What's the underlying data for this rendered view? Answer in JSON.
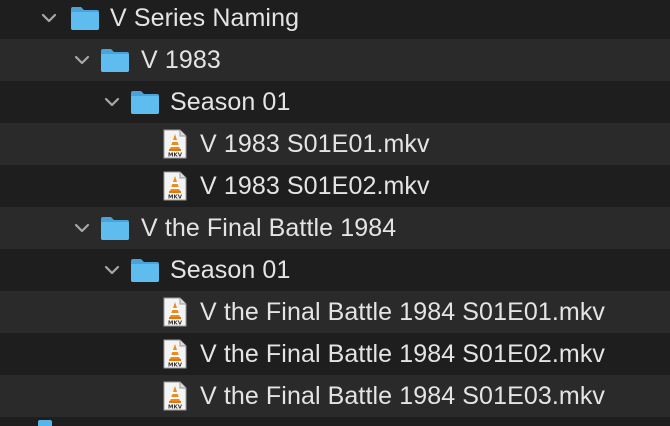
{
  "tree": {
    "rows": [
      {
        "kind": "folder",
        "label": "V Series Naming",
        "level": 0,
        "expanded": true
      },
      {
        "kind": "folder",
        "label": "V 1983",
        "level": 1,
        "expanded": true
      },
      {
        "kind": "folder",
        "label": "Season 01",
        "level": 2,
        "expanded": true
      },
      {
        "kind": "file",
        "label": "V 1983 S01E01.mkv",
        "level": 3
      },
      {
        "kind": "file",
        "label": "V 1983 S01E02.mkv",
        "level": 3
      },
      {
        "kind": "folder",
        "label": "V the Final Battle 1984",
        "level": 1,
        "expanded": true
      },
      {
        "kind": "folder",
        "label": "Season 01",
        "level": 2,
        "expanded": true
      },
      {
        "kind": "file",
        "label": "V the Final Battle 1984 S01E01.mkv",
        "level": 3
      },
      {
        "kind": "file",
        "label": "V the Final Battle 1984 S01E02.mkv",
        "level": 3
      },
      {
        "kind": "file",
        "label": "V the Final Battle 1984 S01E03.mkv",
        "level": 3
      }
    ]
  },
  "icons": {
    "folder": "folder-icon",
    "file": "mkv-file-icon",
    "disclosure": "chevron-down-icon"
  },
  "colors": {
    "folder_fill": "#58b5ea",
    "folder_tab": "#4aa3d8",
    "text": "#e4e4e4",
    "row_alt": "#2a2a2a",
    "background": "#1e1e1e"
  }
}
